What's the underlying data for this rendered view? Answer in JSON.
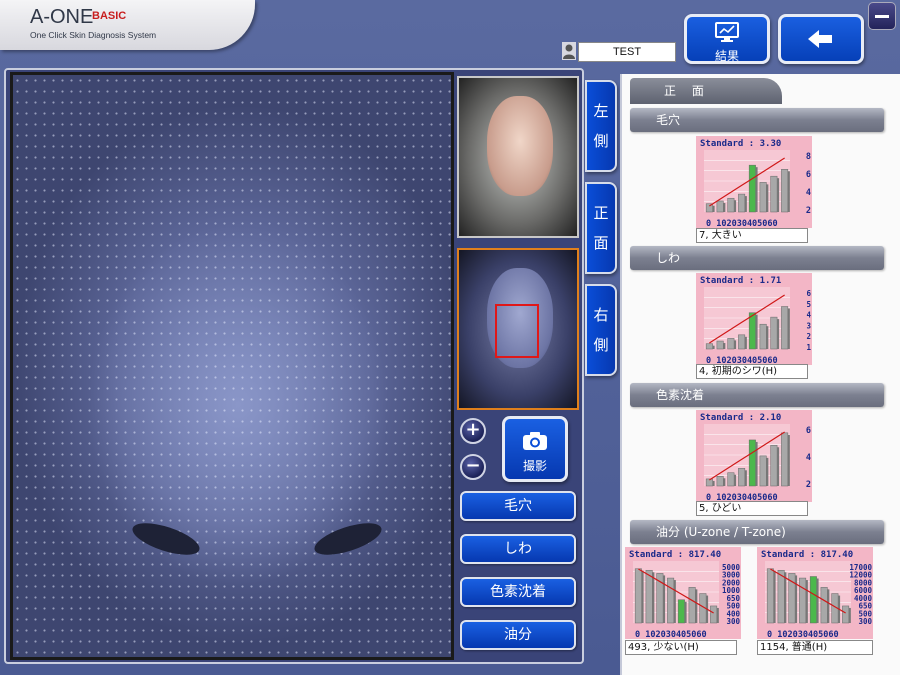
{
  "app": {
    "logo_main": "A-ONE",
    "logo_edition": "BASIC",
    "logo_subtitle": "One Click Skin Diagnosis System"
  },
  "header": {
    "user_name": "TEST",
    "result_button_label": "結果",
    "result_icon": "monitor-chart-icon",
    "back_icon": "arrow-left-icon",
    "minimize_icon": "minimize-icon"
  },
  "side_tabs": [
    {
      "chars": [
        "左",
        "側"
      ]
    },
    {
      "chars": [
        "正",
        "面"
      ]
    },
    {
      "chars": [
        "右",
        "側"
      ]
    }
  ],
  "controls": {
    "zoom_in": "+",
    "zoom_out": "−",
    "shoot_label": "撮影",
    "categories": [
      "毛穴",
      "しわ",
      "色素沈着",
      "油分"
    ]
  },
  "results": {
    "view_tab": "正 面",
    "sections": [
      {
        "title": "毛穴",
        "charts": [
          {
            "title": "Standard : 3.30",
            "x_tick_labels": "0 102030405060",
            "y_ticks": [
              "8",
              "6",
              "4",
              "2"
            ],
            "result_text": "7, 大きい",
            "highlight_index": 4,
            "bar_values": [
              1.2,
              1.6,
              2.0,
              2.6,
              6.8,
              4.3,
              5.2,
              6.2
            ],
            "ymax": 9,
            "trend": "up"
          }
        ]
      },
      {
        "title": "しわ",
        "charts": [
          {
            "title": "Standard : 1.71",
            "x_tick_labels": "0 102030405060",
            "y_ticks": [
              "6",
              "5",
              "4",
              "3",
              "2",
              "1"
            ],
            "result_text": "4, 初期のシワ(H)",
            "highlight_index": 4,
            "bar_values": [
              0.6,
              0.9,
              1.2,
              1.6,
              4.1,
              2.8,
              3.6,
              4.8
            ],
            "ymax": 7,
            "trend": "up"
          }
        ]
      },
      {
        "title": "色素沈着",
        "charts": [
          {
            "title": "Standard : 2.10",
            "x_tick_labels": "0 102030405060",
            "y_ticks": [
              "6",
              "4",
              "2"
            ],
            "result_text": "5, ひどい",
            "highlight_index": 4,
            "bar_values": [
              0.8,
              1.1,
              1.5,
              2.0,
              5.2,
              3.4,
              4.6,
              6.0
            ],
            "ymax": 7,
            "trend": "up"
          }
        ]
      },
      {
        "title": "油分 (U-zone / T-zone)",
        "charts": [
          {
            "title": "Standard : 817.40",
            "x_tick_labels": "0 102030405060",
            "y_ticks": [
              "5000",
              "3000",
              "2000",
              "1000",
              "650",
              "500",
              "400",
              "300"
            ],
            "result_text": "493, 少ない(H)",
            "highlight_index": 4,
            "bar_values": [
              7.0,
              6.8,
              6.4,
              5.8,
              3.0,
              4.6,
              3.8,
              2.2
            ],
            "ymax": 8,
            "trend": "down"
          },
          {
            "title": "Standard : 817.40",
            "x_tick_labels": "0 102030405060",
            "y_ticks": [
              "17000",
              "12000",
              "8000",
              "6000",
              "4000",
              "650",
              "500",
              "300"
            ],
            "result_text": "1154, 普通(H)",
            "highlight_index": 4,
            "bar_values": [
              7.0,
              6.8,
              6.4,
              5.8,
              6.0,
              4.6,
              3.8,
              2.2
            ],
            "ymax": 8,
            "trend": "down"
          }
        ]
      }
    ]
  },
  "colors": {
    "accent_blue": "#0a4ed8",
    "chart_bg": "#f6c8d4",
    "bar_gray": "#a8a8a8",
    "bar_green": "#4cb84c",
    "trend_red": "#d01818",
    "chart_title_blue": "#1a2a8a"
  }
}
